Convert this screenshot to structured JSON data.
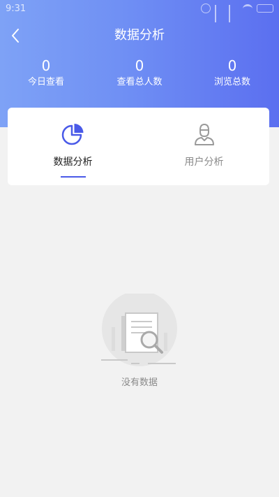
{
  "status_bar": {
    "time": "9:31"
  },
  "header": {
    "title": "数据分析",
    "stats": [
      {
        "value": "0",
        "label": "今日查看"
      },
      {
        "value": "0",
        "label": "查看总人数"
      },
      {
        "value": "0",
        "label": "浏览总数"
      }
    ]
  },
  "tabs": [
    {
      "label": "数据分析",
      "icon": "pie-chart-icon",
      "active": true
    },
    {
      "label": "用户分析",
      "icon": "user-icon",
      "active": false
    }
  ],
  "empty_state": {
    "text": "没有数据",
    "icon": "document-search-icon"
  },
  "colors": {
    "accent": "#4a5ae8",
    "header_start": "#7ea2f6",
    "header_end": "#5b6ff0"
  }
}
